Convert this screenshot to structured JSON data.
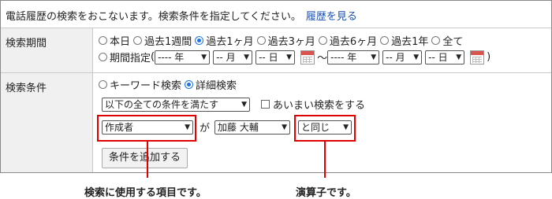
{
  "header": {
    "message": "電話履歴の検索をおこないます。検索条件を指定してください。",
    "link": "履歴を見る"
  },
  "period": {
    "label": "検索期間",
    "options": [
      "本日",
      "過去1週間",
      "過去1ヶ月",
      "過去3ヶ月",
      "過去6ヶ月",
      "過去1年",
      "全て"
    ],
    "selected": "過去1ヶ月",
    "custom_label": "期間指定",
    "open_paren": "(",
    "close_paren": ")",
    "tilde": "～",
    "from": {
      "year": "---- 年",
      "month": "-- 月",
      "day": "-- 日"
    },
    "to": {
      "year": "---- 年",
      "month": "-- 月",
      "day": "-- 日"
    }
  },
  "conditions": {
    "label": "検索条件",
    "mode_options": [
      "キーワード検索",
      "詳細検索"
    ],
    "mode_selected": "詳細検索",
    "match_select": "以下の全ての条件を満たす",
    "fuzzy_label": "あいまい検索をする",
    "fuzzy_checked": false,
    "item_select": "作成者",
    "particle": "が",
    "value_select": "加藤 大輔",
    "operator_select": "と同じ",
    "add_button": "条件を追加する"
  },
  "annotations": {
    "item_callout": "検索に使用する項目です。",
    "operator_callout": "演算子です。"
  },
  "colors": {
    "highlight": "#e00000",
    "link": "#1a4fb5",
    "radio_selected": "#1a73e8"
  }
}
